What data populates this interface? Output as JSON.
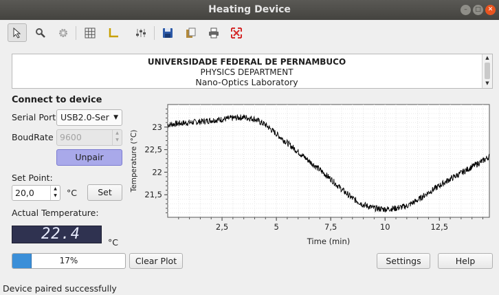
{
  "window": {
    "title": "Heating Device"
  },
  "toolbar": {
    "icons": [
      "pointer-icon",
      "zoom-icon",
      "gear-icon",
      "grid-icon",
      "axes-icon",
      "sliders-icon",
      "save-icon",
      "copy-icon",
      "print-icon",
      "fullscreen-icon"
    ]
  },
  "header": {
    "line1": "UNIVERSIDADE FEDERAL DE PERNAMBUCO",
    "line2": "PHYSICS DEPARTMENT",
    "line3": "Nano-Optics Laboratory"
  },
  "connect": {
    "section_title": "Connect to device",
    "serial_port_label": "Serial Port",
    "serial_port_value": "USB2.0-Ser",
    "baudrate_label": "BoudRate",
    "baudrate_value": "9600",
    "unpair_label": "Unpair"
  },
  "setpoint": {
    "label": "Set Point:",
    "value": "20,0",
    "unit": "°C",
    "set_label": "Set"
  },
  "actual": {
    "label": "Actual Temperature:",
    "lcd_value": "22.4",
    "unit": "°C"
  },
  "progress": {
    "value": 0.17,
    "text": "17%"
  },
  "buttons": {
    "clear_plot": "Clear Plot",
    "settings": "Settings",
    "help": "Help"
  },
  "status": {
    "text": "Device paired successfully"
  },
  "colors": {
    "accent": "#a9a9ea",
    "progress": "#3b8fd8",
    "lcd_bg": "#2f3250",
    "titlebar": "#4c4b47",
    "close": "#e9541f"
  },
  "chart_data": {
    "type": "line",
    "xlabel": "Time (min)",
    "ylabel": "Temperature (°C)",
    "xlim": [
      0,
      14.8
    ],
    "ylim": [
      21.0,
      23.5
    ],
    "x_ticks": [
      "2,5",
      "5",
      "7,5",
      "10",
      "12,5"
    ],
    "x_tick_values": [
      2.5,
      5,
      7.5,
      10,
      12.5
    ],
    "y_ticks": [
      "21,5",
      "22",
      "22,5",
      "23"
    ],
    "y_tick_values": [
      21.5,
      22,
      22.5,
      23
    ],
    "grid": true,
    "series": [
      {
        "x": [
          0,
          0.5,
          1,
          1.5,
          2,
          2.5,
          3,
          3.5,
          4,
          4.5,
          5,
          5.5,
          6,
          6.5,
          7,
          7.5,
          8,
          8.5,
          9,
          9.5,
          10,
          10.5,
          11,
          11.5,
          12,
          12.5,
          13,
          13.5,
          14,
          14.5,
          14.8
        ],
        "y": [
          23.05,
          23.08,
          23.1,
          23.12,
          23.15,
          23.17,
          23.2,
          23.22,
          23.18,
          23.05,
          22.85,
          22.65,
          22.45,
          22.25,
          22.05,
          21.85,
          21.62,
          21.42,
          21.28,
          21.2,
          21.18,
          21.2,
          21.25,
          21.38,
          21.55,
          21.7,
          21.85,
          21.98,
          22.12,
          22.25,
          22.35
        ]
      }
    ]
  }
}
